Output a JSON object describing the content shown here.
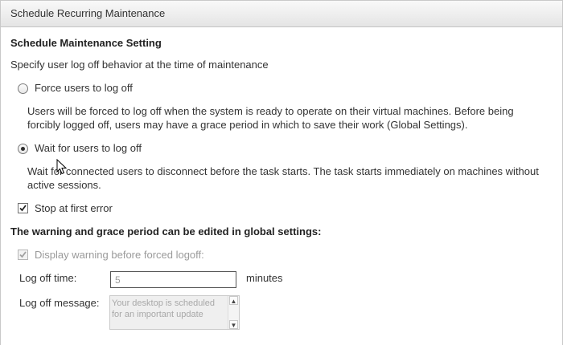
{
  "dialog": {
    "title": "Schedule Recurring Maintenance"
  },
  "section": {
    "heading": "Schedule Maintenance Setting",
    "subtitle": "Specify user log off behavior at the time of maintenance"
  },
  "options": {
    "force": {
      "label": "Force users to log off",
      "checked": false,
      "description": "Users will be forced to log off when the system is ready to operate on their virtual machines. Before being forcibly logged off, users may have a grace period in which to save their work (Global Settings)."
    },
    "wait": {
      "label": "Wait for users to log off",
      "checked": true,
      "description": "Wait for connected users to disconnect before the task starts. The task starts immediately on machines without active sessions."
    }
  },
  "stop_at_first_error": {
    "label": "Stop at first error",
    "checked": true
  },
  "global": {
    "heading": "The warning and grace period can be edited in global settings:",
    "display_warning": {
      "label": "Display warning before forced logoff:",
      "checked": true,
      "enabled": false
    },
    "logoff_time": {
      "label": "Log off time:",
      "value": "5",
      "unit": "minutes"
    },
    "logoff_message": {
      "label": "Log off message:",
      "value": "Your desktop is scheduled for an important update"
    }
  },
  "icons": {
    "scroll_up": "▲",
    "scroll_down": "▼"
  }
}
